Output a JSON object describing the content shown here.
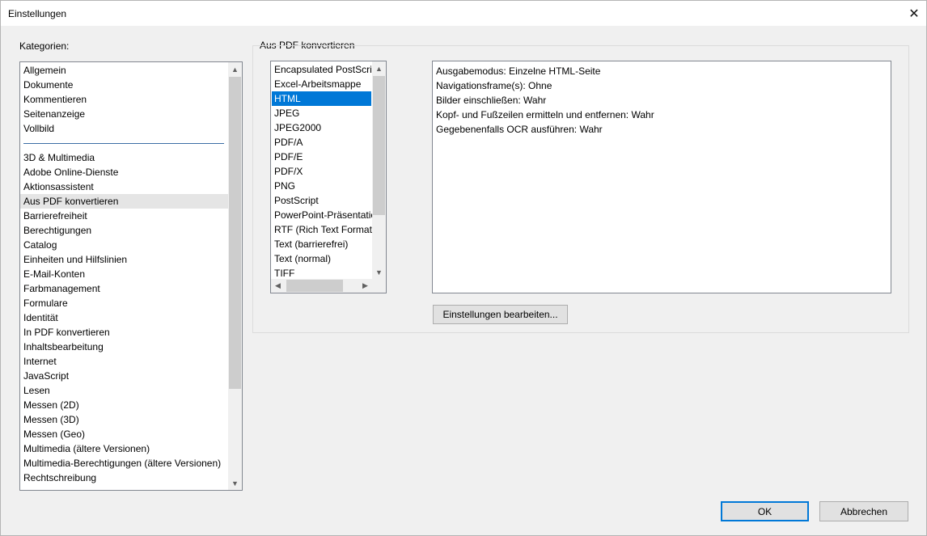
{
  "window": {
    "title": "Einstellungen",
    "close_glyph": "✕"
  },
  "categories": {
    "label": "Kategorien:",
    "top_items": [
      "Allgemein",
      "Dokumente",
      "Kommentieren",
      "Seitenanzeige",
      "Vollbild"
    ],
    "items": [
      "3D & Multimedia",
      "Adobe Online-Dienste",
      "Aktionsassistent",
      "Aus PDF konvertieren",
      "Barrierefreiheit",
      "Berechtigungen",
      "Catalog",
      "Einheiten und Hilfslinien",
      "E-Mail-Konten",
      "Farbmanagement",
      "Formulare",
      "Identität",
      "In PDF konvertieren",
      "Inhaltsbearbeitung",
      "Internet",
      "JavaScript",
      "Lesen",
      "Messen (2D)",
      "Messen (3D)",
      "Messen (Geo)",
      "Multimedia (ältere Versionen)",
      "Multimedia-Berechtigungen (ältere Versionen)",
      "Rechtschreibung"
    ],
    "selected": "Aus PDF konvertieren"
  },
  "group": {
    "label": "Aus PDF konvertieren",
    "formats": [
      "Encapsulated PostScript",
      "Excel-Arbeitsmappe",
      "HTML",
      "JPEG",
      "JPEG2000",
      "PDF/A",
      "PDF/E",
      "PDF/X",
      "PNG",
      "PostScript",
      "PowerPoint-Präsentation",
      "RTF (Rich Text Format)",
      "Text (barrierefrei)",
      "Text (normal)",
      "TIFF"
    ],
    "selected_format": "HTML",
    "details": [
      "Ausgabemodus: Einzelne HTML-Seite",
      "Navigationsframe(s): Ohne",
      "Bilder einschließen: Wahr",
      "Kopf- und Fußzeilen ermitteln und entfernen: Wahr",
      "Gegebenenfalls OCR ausführen: Wahr"
    ],
    "edit_button": "Einstellungen bearbeiten..."
  },
  "footer": {
    "ok_label": "OK",
    "cancel_label": "Abbrechen"
  },
  "icons": {
    "scroll_up": "▲",
    "scroll_down": "▼",
    "scroll_left": "◀",
    "scroll_right": "▶"
  },
  "colors": {
    "selection": "#0078d7",
    "hover_row": "#e5e5e5"
  }
}
